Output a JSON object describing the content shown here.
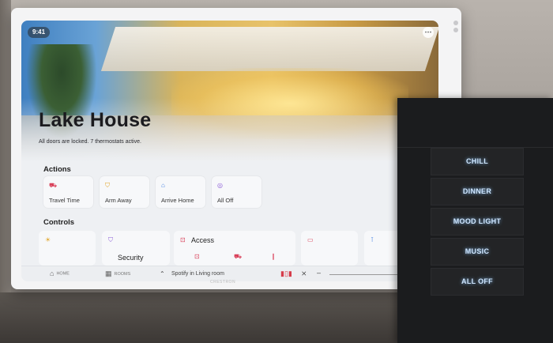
{
  "status": {
    "time": "9:41"
  },
  "hero": {
    "title": "Lake House",
    "subtitle": "All doors are locked. 7 thermostats active."
  },
  "sections": {
    "actions": "Actions",
    "controls": "Controls"
  },
  "actions": [
    {
      "label": "Travel Time",
      "icon": "car-icon",
      "color": "#d9415a"
    },
    {
      "label": "Arm Away",
      "icon": "shield-icon",
      "color": "#e0a11f"
    },
    {
      "label": "Arrive Home",
      "icon": "house-icon",
      "color": "#3f7ee0"
    },
    {
      "label": "All Off",
      "icon": "power-icon",
      "color": "#8a5ad6"
    }
  ],
  "controls": {
    "security_label": "Security",
    "access_label": "Access"
  },
  "bottom_bar": {
    "nav_home": "HOME",
    "nav_rooms": "ROOMS",
    "now_playing": "Spotify in Living room"
  },
  "brand": "CRESTRON",
  "keypad": {
    "buttons": [
      "CHILL",
      "DINNER",
      "MOOD LIGHT",
      "MUSIC",
      "ALL OFF"
    ]
  }
}
